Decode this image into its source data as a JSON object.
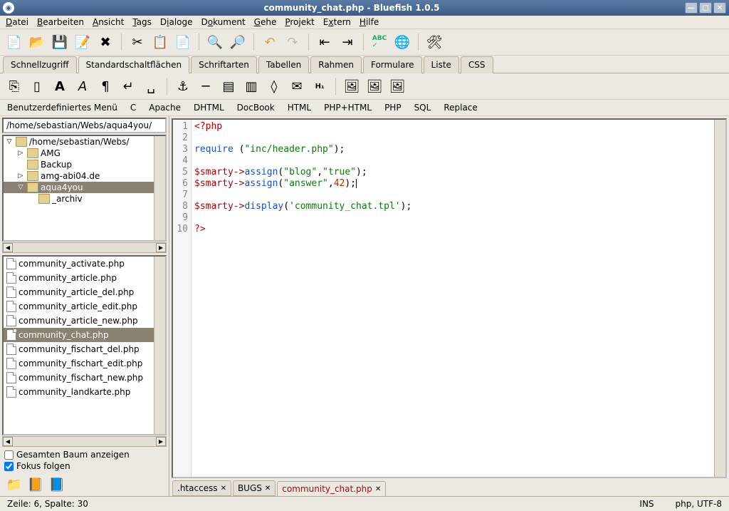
{
  "window": {
    "title": "community_chat.php - Bluefish 1.0.5"
  },
  "menu": {
    "items": [
      "Datei",
      "Bearbeiten",
      "Ansicht",
      "Tags",
      "Dialoge",
      "Dokument",
      "Gehe",
      "Projekt",
      "Extern",
      "Hilfe"
    ]
  },
  "tabs": {
    "items": [
      "Schnellzugriff",
      "Standardschaltflächen",
      "Schriftarten",
      "Tabellen",
      "Rahmen",
      "Formulare",
      "Liste",
      "CSS"
    ],
    "active": 1
  },
  "menubar2": {
    "items": [
      "Benutzerdefiniertes Menü",
      "C",
      "Apache",
      "DHTML",
      "DocBook",
      "HTML",
      "PHP+HTML",
      "PHP",
      "SQL",
      "Replace"
    ]
  },
  "sidebar": {
    "path": "/home/sebastian/Webs/aqua4you/",
    "tree": [
      {
        "indent": 0,
        "expander": "▽",
        "label": "/home/sebastian/Webs/"
      },
      {
        "indent": 1,
        "expander": "▷",
        "label": "AMG"
      },
      {
        "indent": 1,
        "expander": " ",
        "label": "Backup"
      },
      {
        "indent": 1,
        "expander": "▷",
        "label": "amg-abi04.de"
      },
      {
        "indent": 1,
        "expander": "▽",
        "label": "aqua4you",
        "selected": true
      },
      {
        "indent": 2,
        "expander": " ",
        "label": "_archiv"
      }
    ],
    "files": [
      "community_activate.php",
      "community_article.php",
      "community_article_del.php",
      "community_article_edit.php",
      "community_article_new.php",
      "community_chat.php",
      "community_fischart_del.php",
      "community_fischart_edit.php",
      "community_fischart_new.php",
      "community_landkarte.php"
    ],
    "file_selected": 5,
    "check1": "Gesamten Baum anzeigen",
    "check2": "Fokus folgen"
  },
  "code": {
    "lines": 10,
    "l1": "<?php",
    "l3a": "require",
    "l3b": "(",
    "l3c": "\"inc/header.php\"",
    "l3d": ");",
    "l5a": "$smarty",
    "l5b": "->",
    "l5c": "assign",
    "l5d": "(",
    "l5e": "\"blog\"",
    "l5f": ",",
    "l5g": "\"true\"",
    "l5h": ");",
    "l6a": "$smarty",
    "l6b": "->",
    "l6c": "assign",
    "l6d": "(",
    "l6e": "\"answer\"",
    "l6f": ",",
    "l6g": "42",
    "l6h": ");",
    "l8a": "$smarty",
    "l8b": "->",
    "l8c": "display",
    "l8d": "(",
    "l8e": "'community_chat.tpl'",
    "l8f": ");",
    "l10": "?>"
  },
  "doc_tabs": [
    {
      "label": ".htaccess"
    },
    {
      "label": "BUGS"
    },
    {
      "label": "community_chat.php",
      "active": true
    }
  ],
  "status": {
    "pos": "Zeile: 6, Spalte: 30",
    "ins": "INS",
    "enc": "php, UTF-8"
  }
}
